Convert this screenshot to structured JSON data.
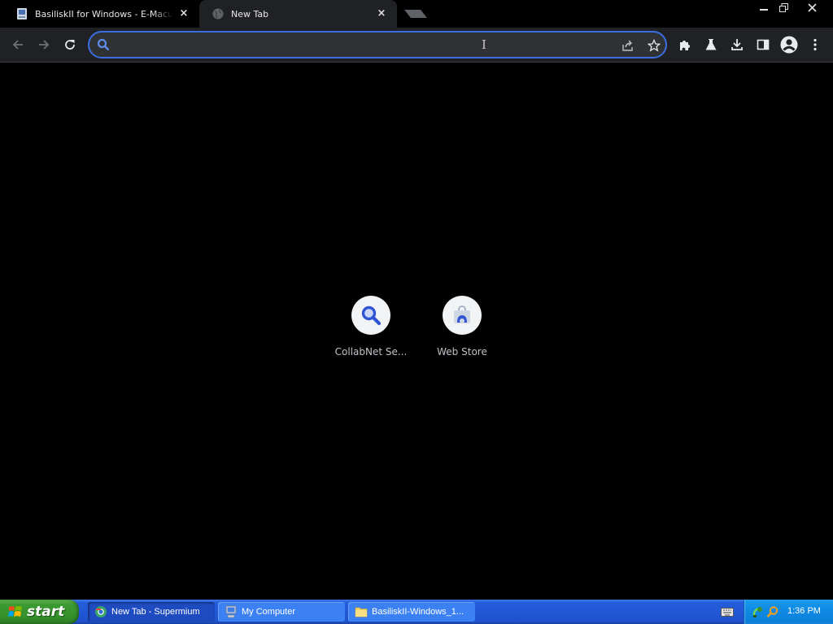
{
  "browser": {
    "tabs": [
      {
        "title": "BasiliskII for Windows - E-Maculation",
        "active": false,
        "close": "×"
      },
      {
        "title": "New Tab",
        "active": true,
        "close": "×"
      }
    ],
    "omnibox": {
      "value": "",
      "placeholder": ""
    },
    "colors": {
      "accent": "#3b6ee0",
      "toolbar": "#202124",
      "background": "#000000"
    }
  },
  "shortcuts": [
    {
      "label": "CollabNet Se...",
      "icon": "magnifier-icon"
    },
    {
      "label": "Web Store",
      "icon": "web-store-icon"
    }
  ],
  "taskbar": {
    "start_label": "start",
    "tasks": [
      {
        "label": "New Tab - Supermium",
        "icon": "browser-icon",
        "active": true
      },
      {
        "label": "My Computer",
        "icon": "computer-icon",
        "active": false
      },
      {
        "label": "BasiliskII-Windows_1...",
        "icon": "folder-icon",
        "active": false
      }
    ],
    "clock": "1:36 PM"
  }
}
